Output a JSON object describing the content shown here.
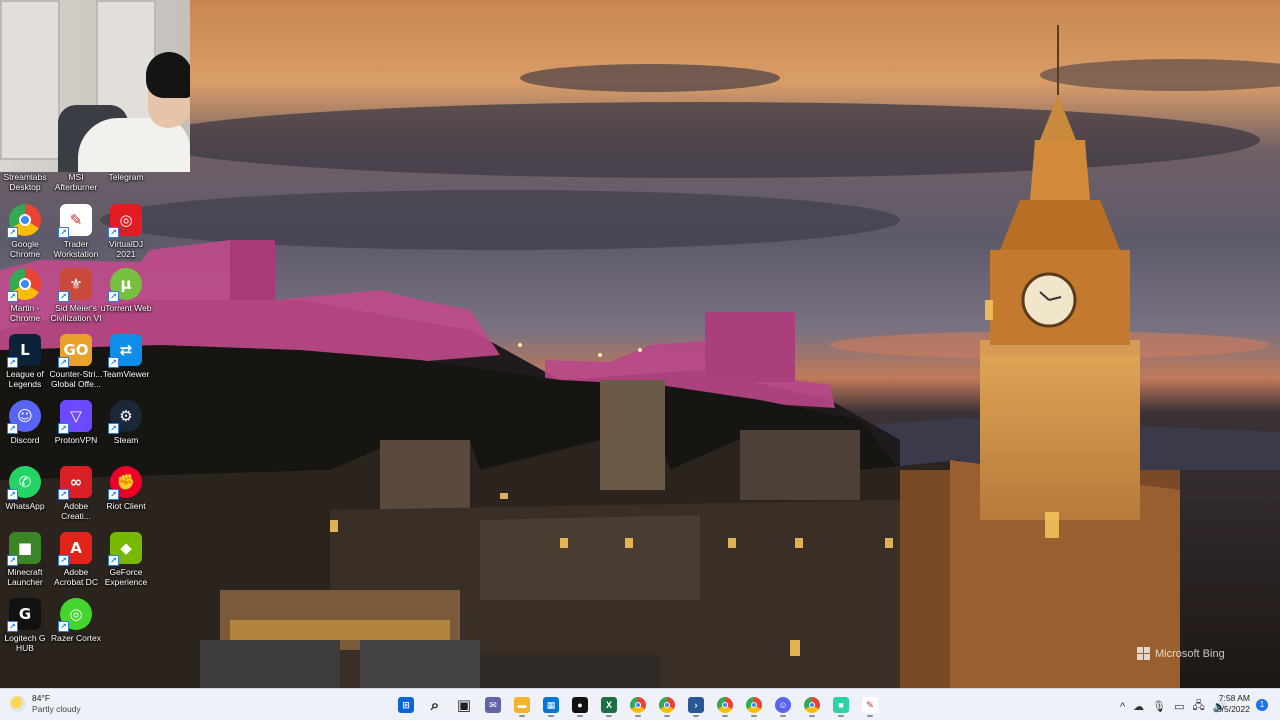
{
  "desktop": {
    "top_row_labels": [
      {
        "label": "Streamlabs\nDesktop"
      },
      {
        "label": "MSI\nAfterburner"
      },
      {
        "label": "Telegram"
      }
    ],
    "icons": [
      {
        "name": "google-chrome",
        "label": "Google\nChrome",
        "glyph": "chrome-icon",
        "color": "#ffffff"
      },
      {
        "name": "trader-workstation",
        "label": "Trader\nWorkstation",
        "glyph": "trader-icon",
        "color": "#ffffff"
      },
      {
        "name": "virtualdj-2021",
        "label": "VirtualDJ\n2021",
        "glyph": "virtualdj-icon",
        "color": "#e31b23"
      },
      {
        "name": "martin-chrome",
        "label": "Martin -\nChrome",
        "glyph": "chrome-icon",
        "color": "#ffffff"
      },
      {
        "name": "civilization-vi",
        "label": "Sid Meier's\nCivilization VI",
        "glyph": "civ-icon",
        "color": "#c94a3c"
      },
      {
        "name": "utorrent-web",
        "label": "uTorrent Web",
        "glyph": "utorrent-icon",
        "color": "#78c140"
      },
      {
        "name": "league-of-legends",
        "label": "League of\nLegends",
        "glyph": "lol-icon",
        "color": "#0b2239"
      },
      {
        "name": "counter-strike",
        "label": "Counter-Stri...\nGlobal Offe...",
        "glyph": "csgo-icon",
        "color": "#e9a12a"
      },
      {
        "name": "teamviewer",
        "label": "TeamViewer",
        "glyph": "teamviewer-icon",
        "color": "#0e8ee9"
      },
      {
        "name": "discord",
        "label": "Discord",
        "glyph": "discord-icon",
        "color": "#5865f2"
      },
      {
        "name": "protonvpn",
        "label": "ProtonVPN",
        "glyph": "protonvpn-icon",
        "color": "#6d4aff"
      },
      {
        "name": "steam",
        "label": "Steam",
        "glyph": "steam-icon",
        "color": "#1b2838"
      },
      {
        "name": "whatsapp",
        "label": "WhatsApp",
        "glyph": "whatsapp-icon",
        "color": "#25d366"
      },
      {
        "name": "adobe-creative-cloud",
        "label": "Adobe\nCreati...",
        "glyph": "creative-cloud-icon",
        "color": "#da1f26"
      },
      {
        "name": "riot-client",
        "label": "Riot Client",
        "glyph": "riot-icon",
        "color": "#eb0029"
      },
      {
        "name": "minecraft-launcher",
        "label": "Minecraft\nLauncher",
        "glyph": "minecraft-icon",
        "color": "#3c8527"
      },
      {
        "name": "adobe-acrobat-dc",
        "label": "Adobe\nAcrobat DC",
        "glyph": "acrobat-icon",
        "color": "#e2231a"
      },
      {
        "name": "geforce-experience",
        "label": "GeForce\nExperience",
        "glyph": "geforce-icon",
        "color": "#76b900"
      },
      {
        "name": "logitech-g-hub",
        "label": "Logitech G\nHUB",
        "glyph": "logitech-icon",
        "color": "#111111"
      },
      {
        "name": "razer-cortex",
        "label": "Razer Cortex",
        "glyph": "razer-icon",
        "color": "#44d62c"
      }
    ]
  },
  "watermark": {
    "text": "Microsoft Bing"
  },
  "taskbar": {
    "weather": {
      "temp": "84°F",
      "condition": "Partly cloudy",
      "icon": "partly-cloudy-icon"
    },
    "apps": [
      {
        "name": "start",
        "icon": "windows-icon",
        "color": "#0a64d8"
      },
      {
        "name": "search",
        "icon": "search-icon",
        "color": "#222222"
      },
      {
        "name": "task-view",
        "icon": "task-view-icon",
        "color": "#222222"
      },
      {
        "name": "teams-chat",
        "icon": "chat-icon",
        "color": "#6264a7"
      },
      {
        "name": "file-explorer",
        "icon": "folder-icon",
        "color": "#f3b32b"
      },
      {
        "name": "microsoft-store",
        "icon": "store-icon",
        "color": "#0078d4"
      },
      {
        "name": "alienware",
        "icon": "alien-icon",
        "color": "#111111"
      },
      {
        "name": "excel",
        "icon": "excel-icon",
        "color": "#1d6f42"
      },
      {
        "name": "chrome-1",
        "icon": "chrome-icon",
        "color": "#ffffff"
      },
      {
        "name": "chrome-2",
        "icon": "chrome-icon",
        "color": "#ffffff"
      },
      {
        "name": "powershell",
        "icon": "terminal-icon",
        "color": "#2b5797"
      },
      {
        "name": "chrome-3",
        "icon": "chrome-icon",
        "color": "#ffffff"
      },
      {
        "name": "chrome-4",
        "icon": "chrome-icon",
        "color": "#ffffff"
      },
      {
        "name": "discord",
        "icon": "discord-icon",
        "color": "#5865f2"
      },
      {
        "name": "chrome-5",
        "icon": "chrome-icon",
        "color": "#ffffff"
      },
      {
        "name": "app-green",
        "icon": "app-icon",
        "color": "#2bd4a4"
      },
      {
        "name": "trader-workstation",
        "icon": "trader-icon",
        "color": "#ffffff"
      }
    ],
    "tray": {
      "chevron": "^",
      "icons": [
        "cloud-icon",
        "mic-icon",
        "display-icon",
        "network-icon",
        "volume-icon"
      ]
    },
    "clock": {
      "time": "7:58 AM",
      "date": "8/5/2022"
    },
    "notification_count": "1"
  }
}
